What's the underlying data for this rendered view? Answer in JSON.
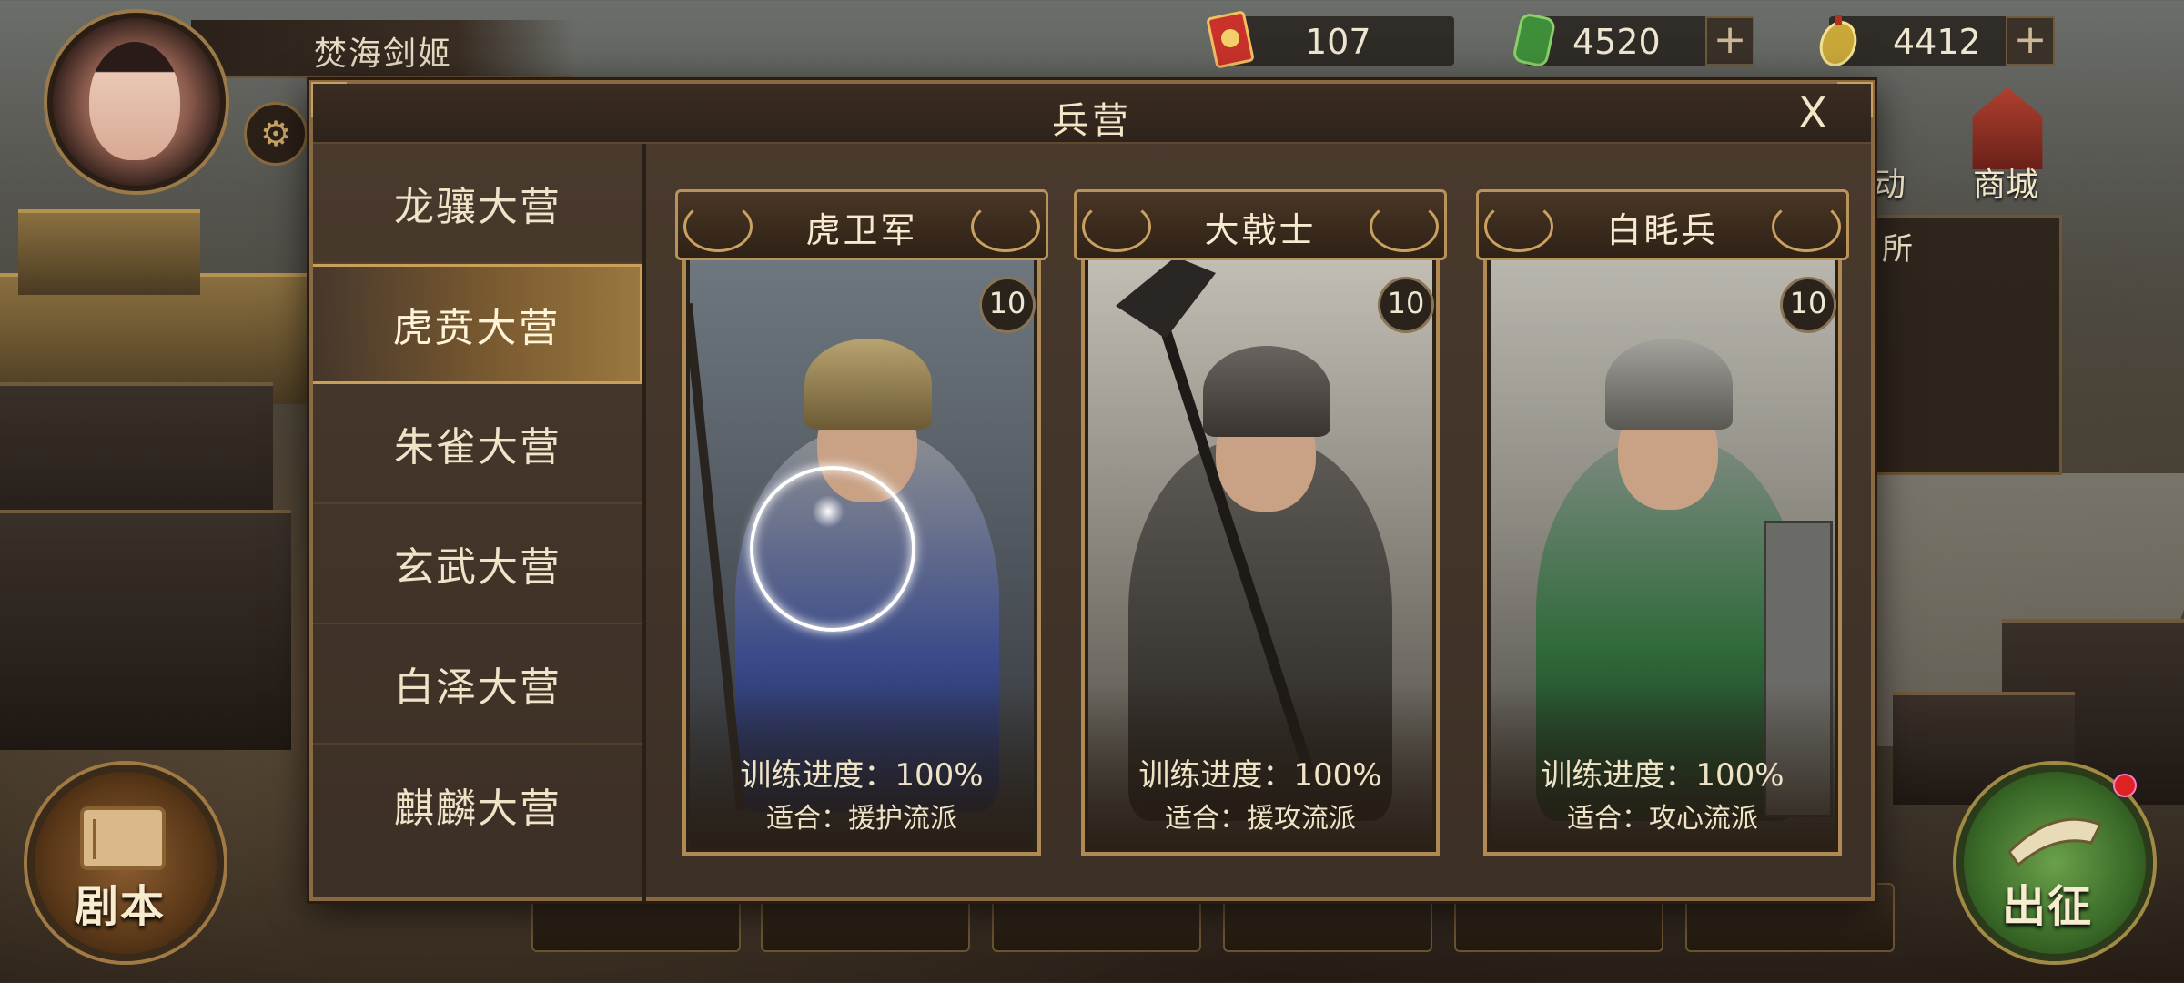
{
  "player": {
    "name": "焚海剑姬"
  },
  "resources": [
    {
      "value": "107",
      "icon": "red-token-icon",
      "has_plus": false
    },
    {
      "value": "4520",
      "icon": "jade-icon",
      "has_plus": true,
      "plus": "+"
    },
    {
      "value": "4412",
      "icon": "gold-jade-icon",
      "has_plus": true,
      "plus": "+"
    }
  ],
  "side": {
    "shop": "商城",
    "activity": "动",
    "panel": "所"
  },
  "dialog": {
    "title": "兵营",
    "close": "X",
    "tabs": [
      {
        "label": "龙骧大营",
        "active": false
      },
      {
        "label": "虎贲大营",
        "active": true
      },
      {
        "label": "朱雀大营",
        "active": false
      },
      {
        "label": "玄武大营",
        "active": false
      },
      {
        "label": "白泽大营",
        "active": false
      },
      {
        "label": "麒麟大营",
        "active": false
      }
    ],
    "cards": [
      {
        "name": "虎卫军",
        "level": "10",
        "progress": "训练进度：100%",
        "suitable": "适合：援护流派"
      },
      {
        "name": "大戟士",
        "level": "10",
        "progress": "训练进度：100%",
        "suitable": "适合：援攻流派"
      },
      {
        "name": "白眊兵",
        "level": "10",
        "progress": "训练进度：100%",
        "suitable": "适合：攻心流派"
      }
    ]
  },
  "buttons": {
    "script": "剧本",
    "go": "出征"
  },
  "colors": {
    "accent_gold": "#c8a05a",
    "panel": "#3c2f25",
    "go_green": "#3a6a28"
  }
}
